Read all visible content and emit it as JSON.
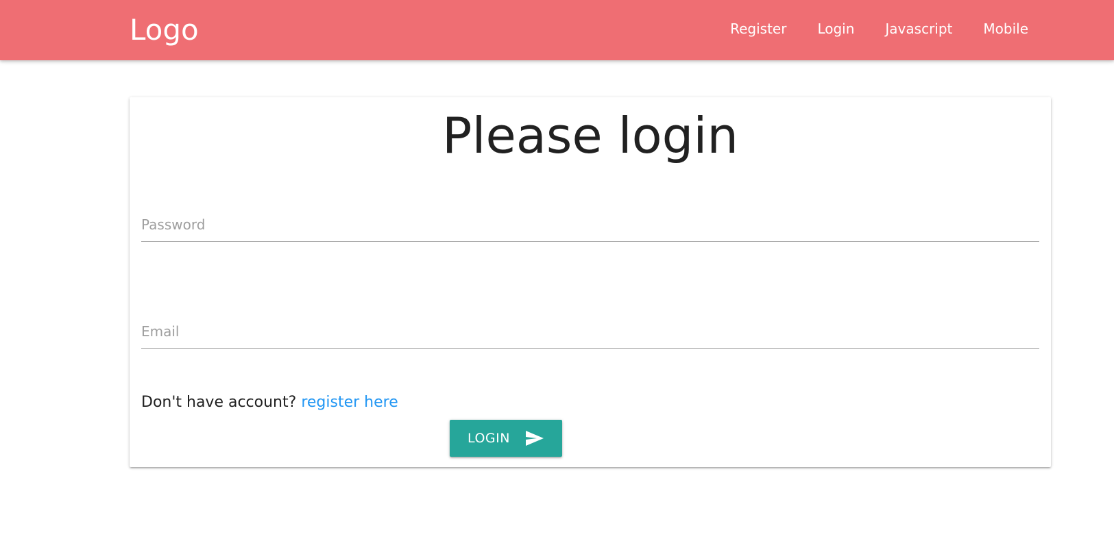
{
  "header": {
    "logo": "Logo",
    "nav": [
      {
        "label": "Register"
      },
      {
        "label": "Login"
      },
      {
        "label": "Javascript"
      },
      {
        "label": "Mobile"
      }
    ],
    "background_color": "#ef6e73"
  },
  "login_card": {
    "title": "Please login",
    "password": {
      "placeholder": "Password",
      "value": ""
    },
    "email": {
      "placeholder": "Email",
      "value": ""
    },
    "register_prompt": "Don't have account?",
    "register_link": "register here",
    "submit_label": "LOGIN",
    "submit_icon": "send-icon",
    "button_color": "#26a69a",
    "link_color": "#2196f3"
  }
}
